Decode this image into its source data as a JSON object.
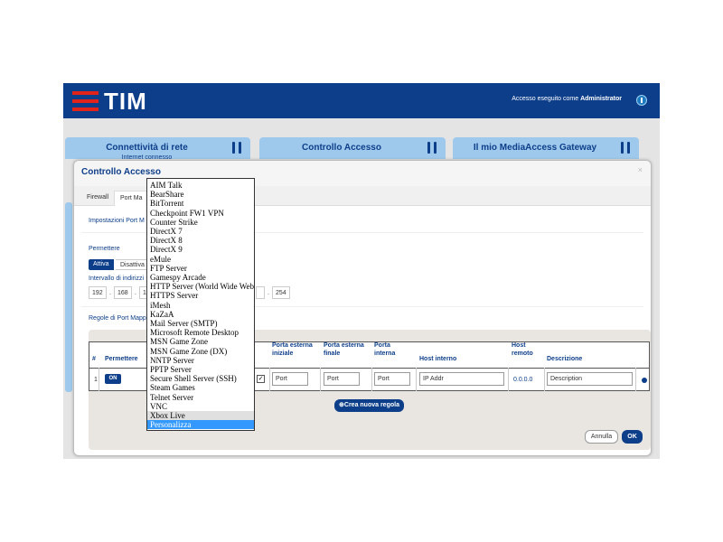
{
  "header": {
    "logo_text": "TIM",
    "login_prefix": "Accesso eseguito come",
    "login_user": "Administrator",
    "colors": {
      "brand_blue": "#0d3e8a",
      "logo_red": "#e2231a",
      "card_blue": "#9fc9ec"
    }
  },
  "cards": [
    {
      "title": "Connettività di rete",
      "subtitle": "Internet connesso"
    },
    {
      "title": "Controllo Accesso",
      "subtitle": ""
    },
    {
      "title": "Il mio MediaAccess Gateway",
      "subtitle": ""
    }
  ],
  "modal": {
    "title": "Controllo Accesso",
    "close": "×",
    "tabs": [
      "Firewall",
      "Port Ma"
    ],
    "port_mapping_settings": "Impostazioni Port M",
    "allow_label": "Permettere",
    "allow_options": [
      "Attiva",
      "Disattiva"
    ],
    "address_range_label": "Intervallo di indirizzi",
    "ip_start": [
      "192",
      "168",
      "1"
    ],
    "ip_end_last": "254",
    "rules_label": "Regole di Port Mapp",
    "table": {
      "headers": {
        "num": "#",
        "allow": "Permettere",
        "ext_start_1": "Porta esterna",
        "ext_start_2": "iniziale",
        "ext_end_1": "Porta esterna",
        "ext_end_2": "finale",
        "int_port_1": "Porta",
        "int_port_2": "interna",
        "int_host": "Host interno",
        "remote_host_1": "Host",
        "remote_host_2": "remoto",
        "description": "Descrizione"
      },
      "row": {
        "num": "1",
        "toggle": "ON",
        "ext_start": "Port",
        "ext_end": "Port",
        "int_port": "Port",
        "int_host": "IP Addr",
        "remote_host": "0.0.0.0",
        "description": "Description",
        "checked": "✓"
      }
    },
    "add_rule_button": "Crea nuova regola",
    "cancel_button": "Annulla",
    "ok_button": "OK"
  },
  "dropdown": {
    "options": [
      "AIM Talk",
      "BearShare",
      "BitTorrent",
      "Checkpoint FW1 VPN",
      "Counter Strike",
      "DirectX 7",
      "DirectX 8",
      "DirectX 9",
      "eMule",
      "FTP Server",
      "Gamespy Arcade",
      "HTTP Server (World Wide Web)",
      "HTTPS Server",
      "iMesh",
      "KaZaA",
      "Mail Server (SMTP)",
      "Microsoft Remote Desktop",
      "MSN Game Zone",
      "MSN Game Zone (DX)",
      "NNTP Server",
      "PPTP Server",
      "Secure Shell Server (SSH)",
      "Steam Games",
      "Telnet Server",
      "VNC",
      "Xbox Live",
      "Personalizza"
    ],
    "hovered": "Xbox Live",
    "selected": "Personalizza"
  }
}
